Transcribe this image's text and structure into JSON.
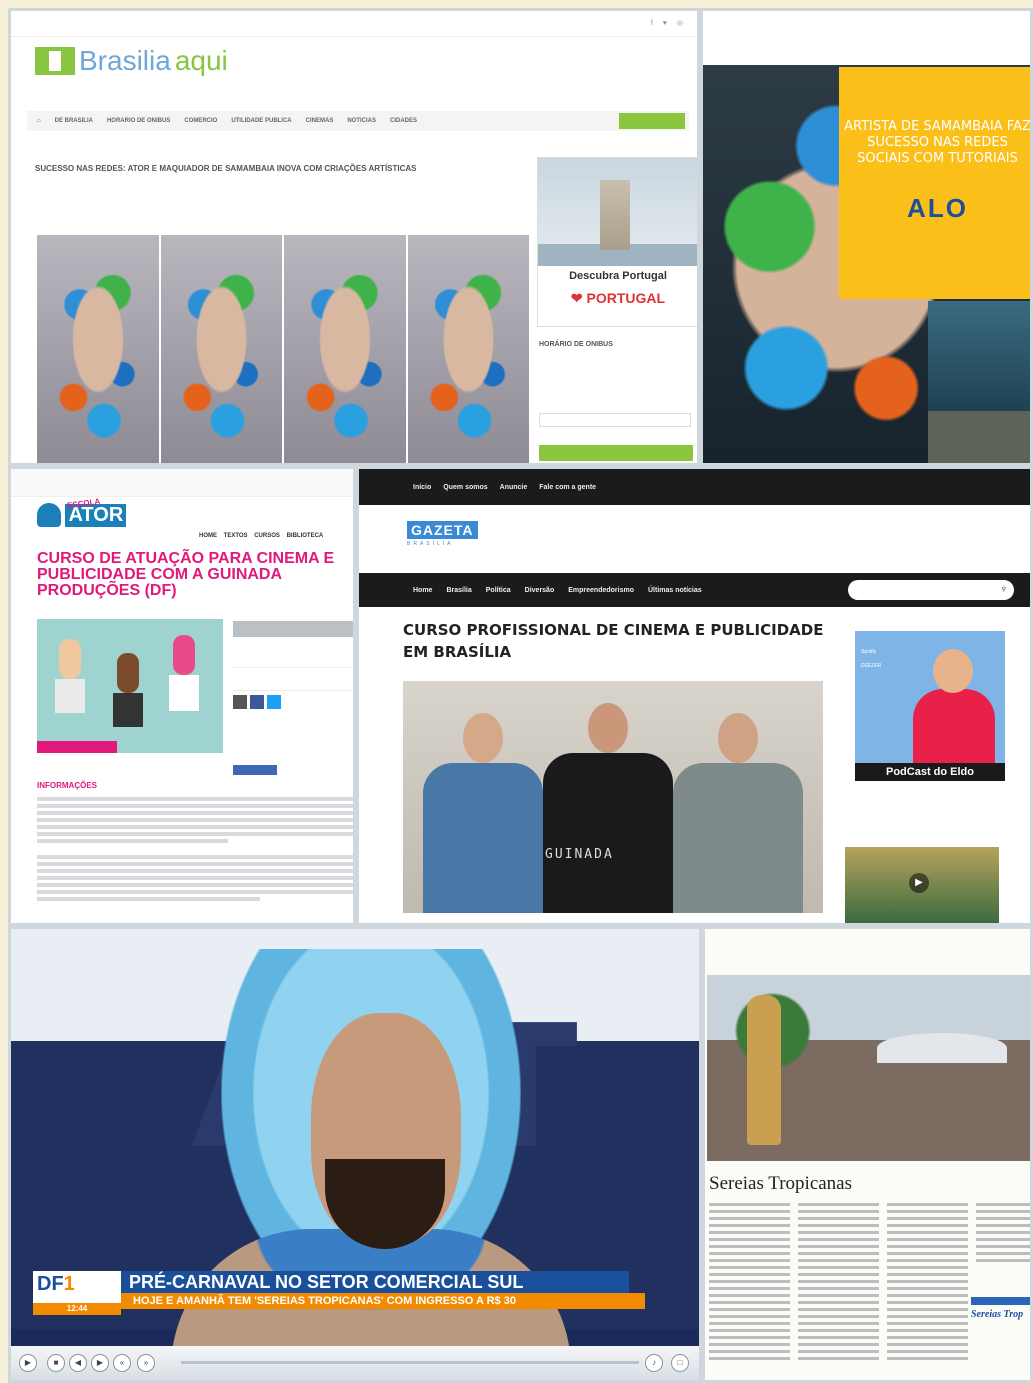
{
  "panel1": {
    "logo_brand": "Brasilia",
    "logo_aqui": "aqui",
    "nav": [
      "DE BRASILIA",
      "HORARIO DE ONIBUS",
      "COMERCIO",
      "UTILIDADE PUBLICA",
      "CINEMAS",
      "NOTICIAS",
      "CIDADES"
    ],
    "headline": "SUCESSO NAS REDES: ATOR E MAQUIADOR DE SAMAMBAIA INOVA COM CRIAÇÕES ARTÍSTICAS",
    "ad_title": "Descubra Portugal",
    "ad_brand": "PORTUGAL",
    "sidebar_heading": "HORÁRIO DE ONIBUS"
  },
  "panel2": {
    "headline": "ARTISTA DE SAMAMBAIA FAZ SUCESSO NAS REDES SOCIAIS COM TUTORIAIS",
    "logo": "ALO"
  },
  "panel3": {
    "logo_small": "ESCOLA",
    "logo_main": "ATOR",
    "nav": "HOME TEXTOS CURSOS BIBLIOTECA",
    "title": "CURSO DE ATUAÇÃO PARA CINEMA E PUBLICIDADE COM A GUINADA PRODUÇÕES (DF)",
    "section": "INFORMAÇÕES"
  },
  "panel4": {
    "topnav": [
      "Início",
      "Quem somos",
      "Anuncie",
      "Fale com a gente"
    ],
    "logo": "GAZETA",
    "logo_sub": "BRASÍLIA",
    "mainnav": [
      "Home",
      "Brasília",
      "Política",
      "Diversão",
      "Empreendedorismo",
      "Últimas notícias"
    ],
    "headline": "CURSO PROFISSIONAL DE CINEMA E PUBLICIDADE EM BRASÍLIA",
    "shirt_text": "GUINADA",
    "podcast_logos": [
      "Spotify",
      "DEEZER"
    ],
    "podcast_caption": "PodCast do Eldo"
  },
  "panel5": {
    "backdrop_text": "ART",
    "logo": "DF",
    "logo_num": "1",
    "time": "12:44",
    "lower_third_1": "PRÉ-CARNAVAL NO SETOR COMERCIAL SUL",
    "lower_third_2": "HOJE E AMANHÃ TEM 'SEREIAS TROPICANAS' COM INGRESSO A R$ 30"
  },
  "panel6": {
    "title": "Sereias Tropicanas",
    "box_title": "Sereias Trop"
  }
}
